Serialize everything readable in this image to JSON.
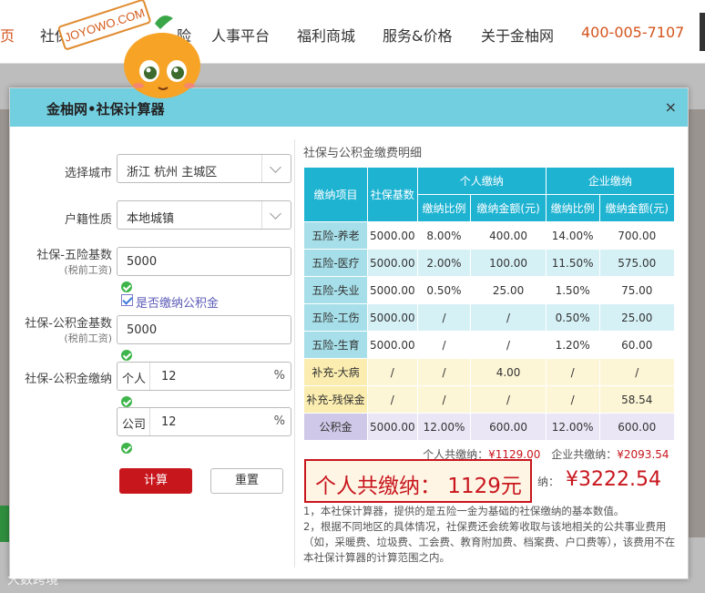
{
  "nav": {
    "home": "页",
    "items": [
      "社保",
      "人事平台",
      "福利商城",
      "服务&价格",
      "关于金柚网"
    ],
    "partial": "险",
    "phone": "400-005-7107"
  },
  "mascot": {
    "sign": "JOYOWO.COM"
  },
  "watermark": "大数跨境",
  "modal": {
    "title": "金柚网•社保计算器",
    "close": "×"
  },
  "form": {
    "city_label": "选择城市",
    "city_value": "浙江 杭州 主城区",
    "hukou_label": "户籍性质",
    "hukou_value": "本地城镇",
    "si_base_label": "社保-五险基数",
    "si_base_sub": "(税前工资)",
    "si_base_value": "5000",
    "fund_checkbox": "是否缴纳公积金",
    "fund_base_label": "社保-公积金基数",
    "fund_base_sub": "(税前工资)",
    "fund_base_value": "5000",
    "fund_pay_label": "社保-公积金缴纳",
    "personal_prefix": "个人",
    "personal_value": "12",
    "company_prefix": "公司",
    "company_value": "12",
    "percent": "%",
    "calc_button": "计算",
    "reset_button": "重置"
  },
  "table": {
    "title": "社保与公积金缴费明细",
    "headers": {
      "item": "缴纳项目",
      "base": "社保基数",
      "personal": "个人缴纳",
      "company": "企业缴纳",
      "ratio": "缴纳比例",
      "amount": "缴纳金额(元)"
    },
    "rows": [
      {
        "item": "五险-养老",
        "base": "5000.00",
        "p_ratio": "8.00%",
        "p_amount": "400.00",
        "c_ratio": "14.00%",
        "c_amount": "700.00"
      },
      {
        "item": "五险-医疗",
        "base": "5000.00",
        "p_ratio": "2.00%",
        "p_amount": "100.00",
        "c_ratio": "11.50%",
        "c_amount": "575.00"
      },
      {
        "item": "五险-失业",
        "base": "5000.00",
        "p_ratio": "0.50%",
        "p_amount": "25.00",
        "c_ratio": "1.50%",
        "c_amount": "75.00"
      },
      {
        "item": "五险-工伤",
        "base": "5000.00",
        "p_ratio": "/",
        "p_amount": "/",
        "c_ratio": "0.50%",
        "c_amount": "25.00"
      },
      {
        "item": "五险-生育",
        "base": "5000.00",
        "p_ratio": "/",
        "p_amount": "/",
        "c_ratio": "1.20%",
        "c_amount": "60.00"
      },
      {
        "item": "补充-大病",
        "base": "/",
        "p_ratio": "/",
        "p_amount": "4.00",
        "c_ratio": "/",
        "c_amount": "/"
      },
      {
        "item": "补充-残保金",
        "base": "/",
        "p_ratio": "/",
        "p_amount": "/",
        "c_ratio": "/",
        "c_amount": "58.54"
      },
      {
        "item": "公积金",
        "base": "5000.00",
        "p_ratio": "12.00%",
        "p_amount": "600.00",
        "c_ratio": "12.00%",
        "c_amount": "600.00"
      }
    ],
    "personal_total_label": "个人共缴纳：",
    "personal_total": "¥1129.00",
    "company_total_label": "企业共缴纳：",
    "company_total": "¥2093.54",
    "grand_label": "总缴纳：",
    "grand_label_visible": "纳：",
    "grand_total": "¥3222.54"
  },
  "highlight": "个人共缴纳：  1129元",
  "notes": [
    "1，本社保计算器，提供的是五险一金为基础的社保缴纳的基本数值。",
    "2，根据不同地区的具体情况，社保费还会统筹收取与该地相关的公共事业费用（如，采暖费、垃圾费、工会费、教育附加费、档案费、户口费等），该费用不在本社保计算器的计算范围之内。"
  ],
  "colors": {
    "accent": "#c8161d",
    "header": "#72cfe0",
    "table_head": "#1fb3d2"
  }
}
